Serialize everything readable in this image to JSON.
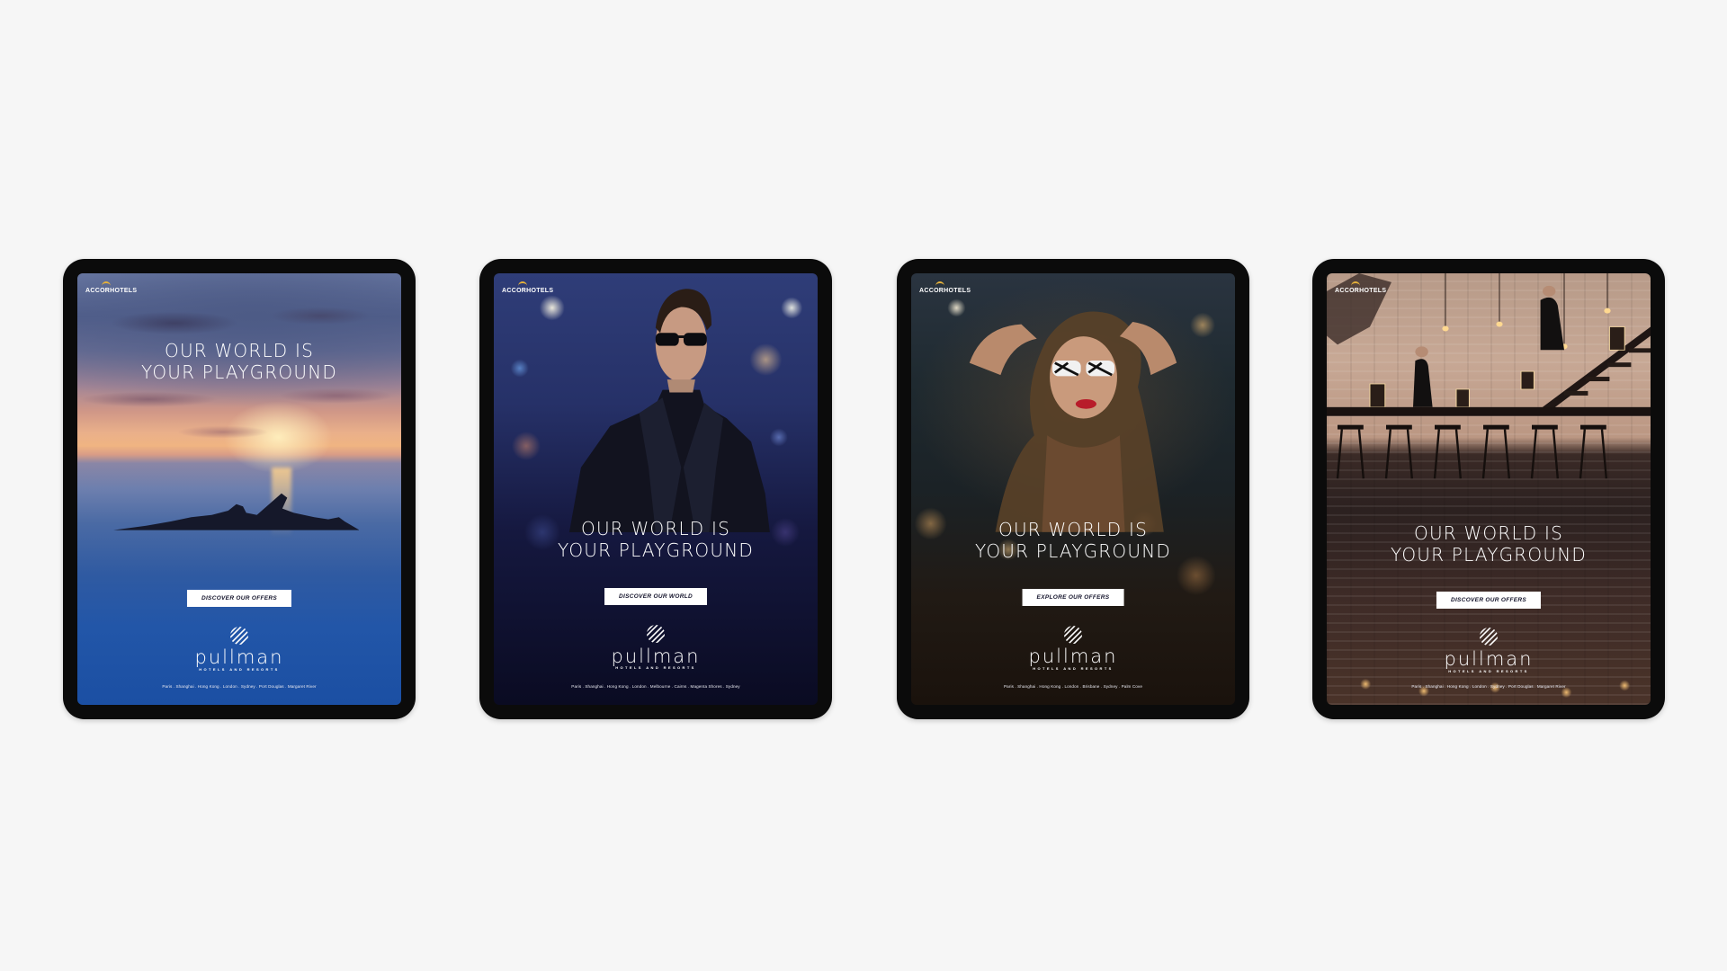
{
  "brand": "ACCORHOTELS",
  "logo": {
    "wordmark": "pullman",
    "tagline": "HOTELS AND RESORTS"
  },
  "colors": {
    "page_background": "#f6f6f6",
    "device_frame": "#0b0b0b",
    "cta_background": "#ffffff",
    "cta_text": "#12122a",
    "brand_mark": "#e6b23a"
  },
  "ads": [
    {
      "headline_line1": "OUR WORLD IS",
      "headline_line2": "YOUR PLAYGROUND",
      "cta": "DISCOVER OUR OFFERS",
      "cities": "Paris . Shanghai . Hong Kong . London . Sydney . Port Douglas . Margaret River",
      "photo": "sunset-infinity-pool"
    },
    {
      "headline_line1": "OUR WORLD IS",
      "headline_line2": "YOUR PLAYGROUND",
      "cta": "DISCOVER OUR WORLD",
      "cities": "Paris . Shanghai . Hong Kong . London . Melbourne . Cairns . Magenta Shores . Sydney",
      "photo": "man-in-sunglasses"
    },
    {
      "headline_line1": "OUR WORLD IS",
      "headline_line2": "YOUR PLAYGROUND",
      "cta": "EXPLORE OUR OFFERS",
      "cities": "Paris . Shanghai . Hong Kong . London . Brisbane . Sydney . Palm Cove",
      "photo": "woman-with-sunglasses"
    },
    {
      "headline_line1": "OUR WORLD IS",
      "headline_line2": "YOUR PLAYGROUND",
      "cta": "DISCOVER OUR OFFERS",
      "cities": "Paris . Shanghai . Hong Kong . London . Sydney . Port Douglas . Margaret River",
      "photo": "bar-with-lanterns"
    }
  ]
}
